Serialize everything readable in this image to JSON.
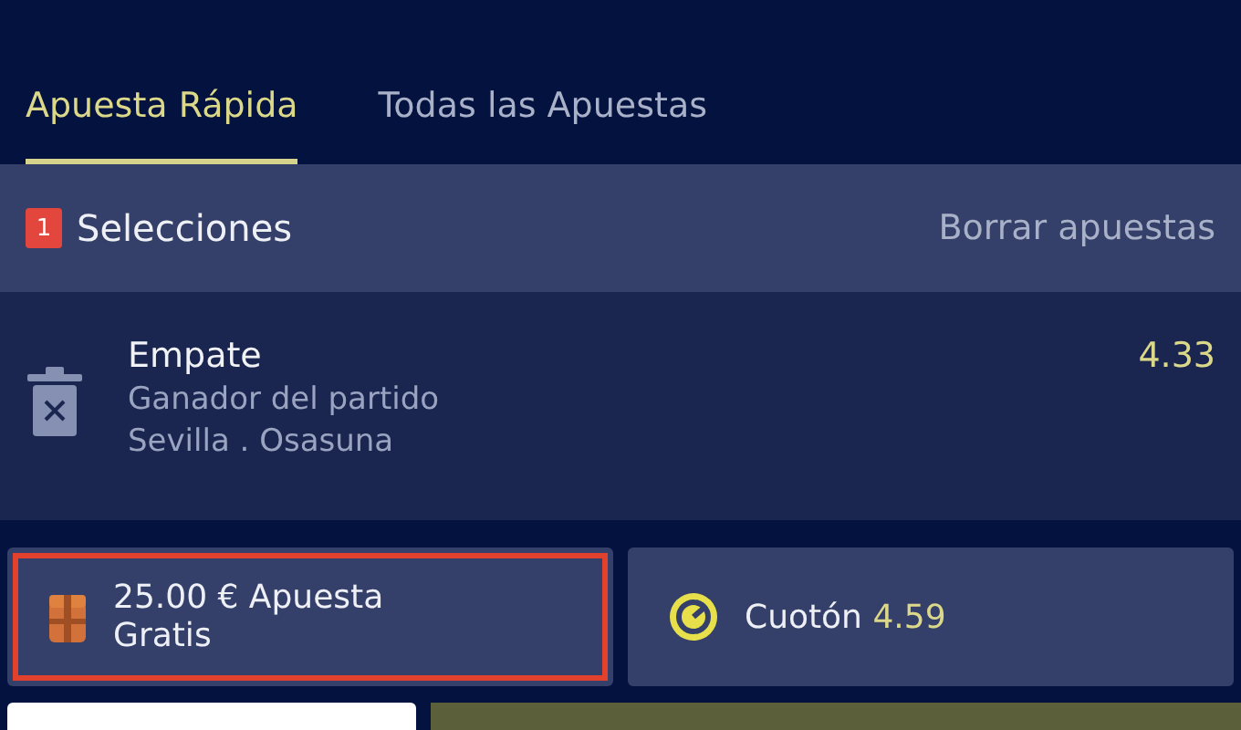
{
  "tabs": [
    {
      "label": "Apuesta Rápida",
      "selected": true
    },
    {
      "label": "Todas las Apuestas",
      "selected": false
    }
  ],
  "selections_header": {
    "count": "1",
    "title": "Selecciones",
    "clear_link": "Borrar apuestas"
  },
  "selections": [
    {
      "outcome": "Empate",
      "market": "Ganador del partido",
      "event": "Sevilla . Osasuna",
      "odds": "4.33"
    }
  ],
  "options": [
    {
      "kind": "freebet",
      "label": "25.00 € Apuesta Gratis",
      "highlighted": true
    },
    {
      "kind": "boost",
      "label": "Cuotón",
      "value": "4.59",
      "highlighted": false
    }
  ]
}
